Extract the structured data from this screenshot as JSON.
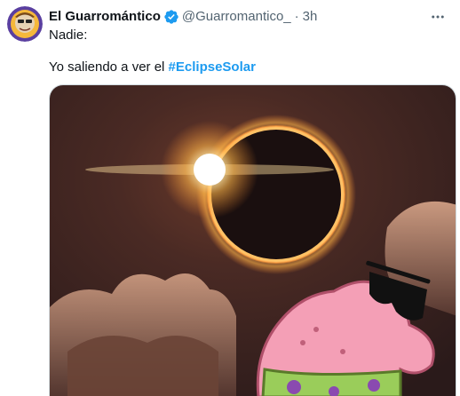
{
  "tweet": {
    "author": {
      "display_name": "El Guarromántico",
      "handle": "@Guarromantico_",
      "verified": true,
      "avatar_icon": "profile-avatar"
    },
    "separator": "·",
    "time": "3h",
    "more_icon": "more-options-icon",
    "text_line1": "Nadie:",
    "text_line2_prefix": "Yo saliendo a ver el ",
    "hashtag": "#EclipseSolar",
    "media": {
      "alt": "Solar eclipse ring with Patrick Star wearing sunglasses",
      "colors": {
        "sky": "#3a2420",
        "ring": "#ffb347",
        "patrick": "#f49fb6"
      }
    }
  },
  "colors": {
    "accent": "#1d9bf0",
    "text": "#0f1419",
    "muted": "#536471"
  }
}
